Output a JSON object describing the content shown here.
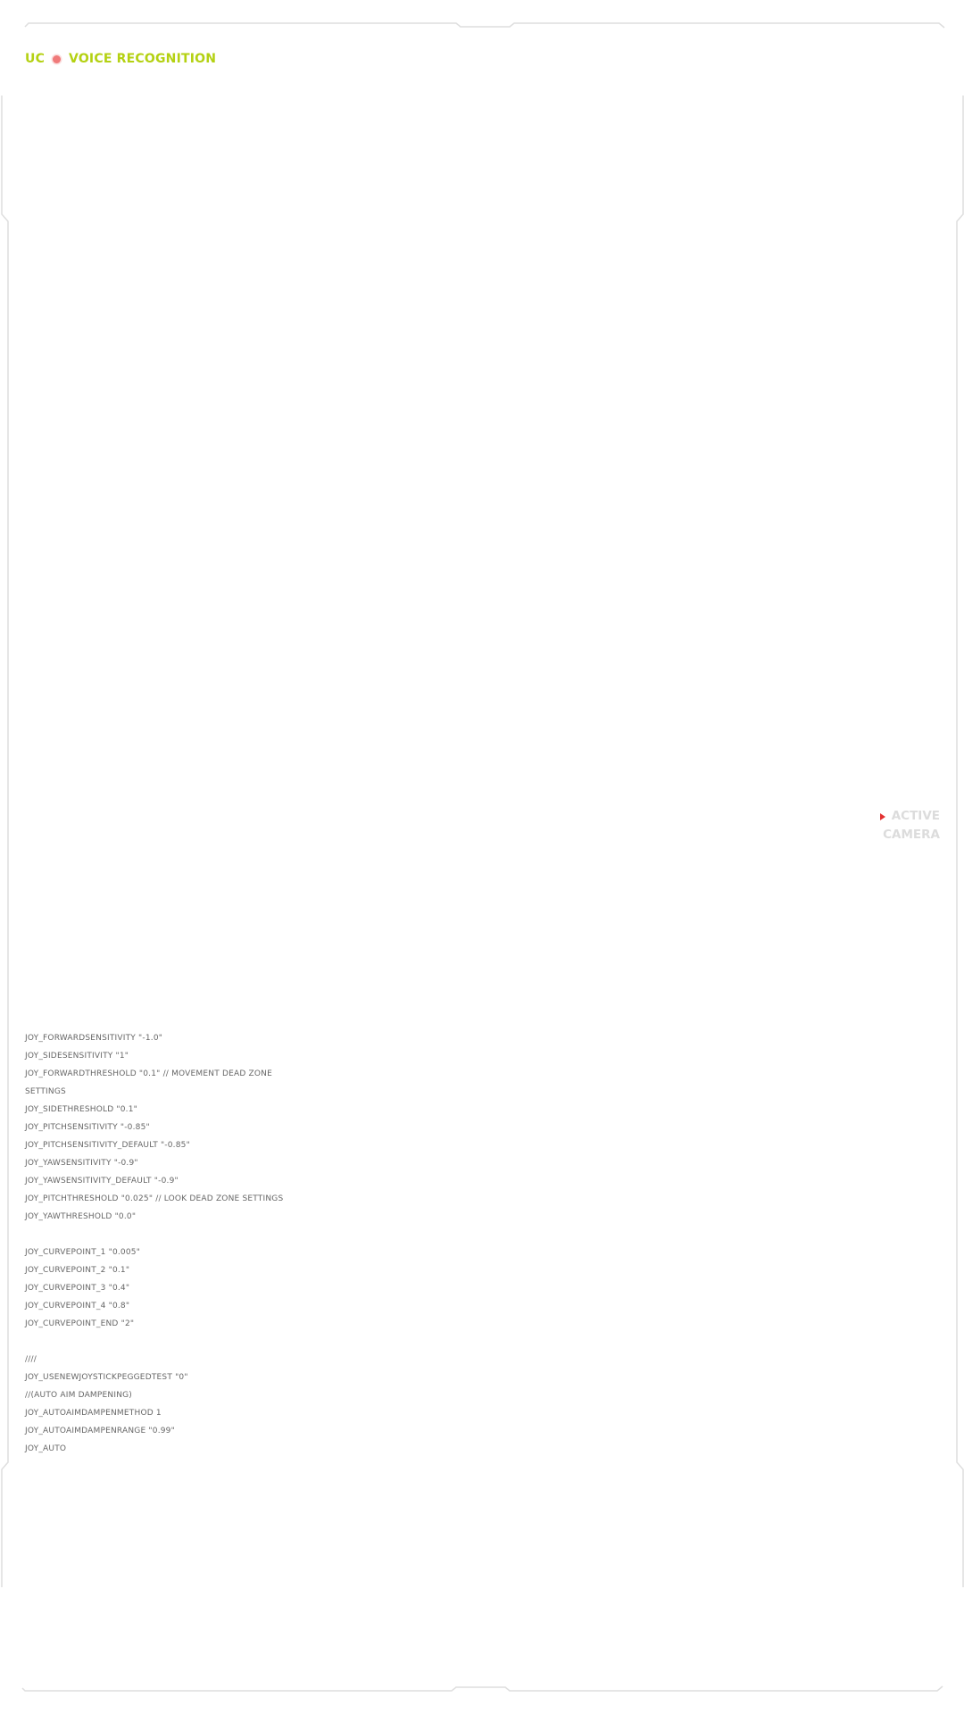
{
  "header": {
    "prefix": "UC",
    "title": "VOICE RECOGNITION"
  },
  "camera": {
    "line1": "ACTIVE",
    "line2": "CAMERA",
    "indicator_icon": "play-triangle-icon",
    "indicator_color": "#e33131"
  },
  "console": {
    "lines": [
      "JOY_FORWARDSENSITIVITY \"-1.0\"",
      "JOY_SIDESENSITIVITY \"1\"",
      "JOY_FORWARDTHRESHOLD \"0.1\" // MOVEMENT DEAD ZONE",
      "SETTINGS",
      "JOY_SIDETHRESHOLD \"0.1\"",
      "JOY_PITCHSENSITIVITY \"-0.85\"",
      "JOY_PITCHSENSITIVITY_DEFAULT \"-0.85\"",
      "JOY_YAWSENSITIVITY \"-0.9\"",
      "JOY_YAWSENSITIVITY_DEFAULT \"-0.9\"",
      "JOY_PITCHTHRESHOLD \"0.025\" // LOOK DEAD ZONE SETTINGS",
      "JOY_YAWTHRESHOLD \"0.0\"",
      "",
      "JOY_CURVEPOINT_1 \"0.005\"",
      "JOY_CURVEPOINT_2 \"0.1\"",
      "JOY_CURVEPOINT_3 \"0.4\"",
      "JOY_CURVEPOINT_4 \"0.8\"",
      "JOY_CURVEPOINT_END \"2\"",
      "",
      "////",
      "JOY_USENEWJOYSTICKPEGGEDTEST \"0\"",
      "//(AUTO AIM DAMPENING)",
      "JOY_AUTOAIMDAMPENMETHOD 1",
      "JOY_AUTOAIMDAMPENRANGE \"0.99\"",
      "JOY_AUTO"
    ]
  },
  "colors": {
    "accent": "#b4d112",
    "recording_dot": "#f07a7a",
    "console_text": "#666666",
    "frame_line": "#dedede",
    "camera_text": "#dcdcdc"
  }
}
